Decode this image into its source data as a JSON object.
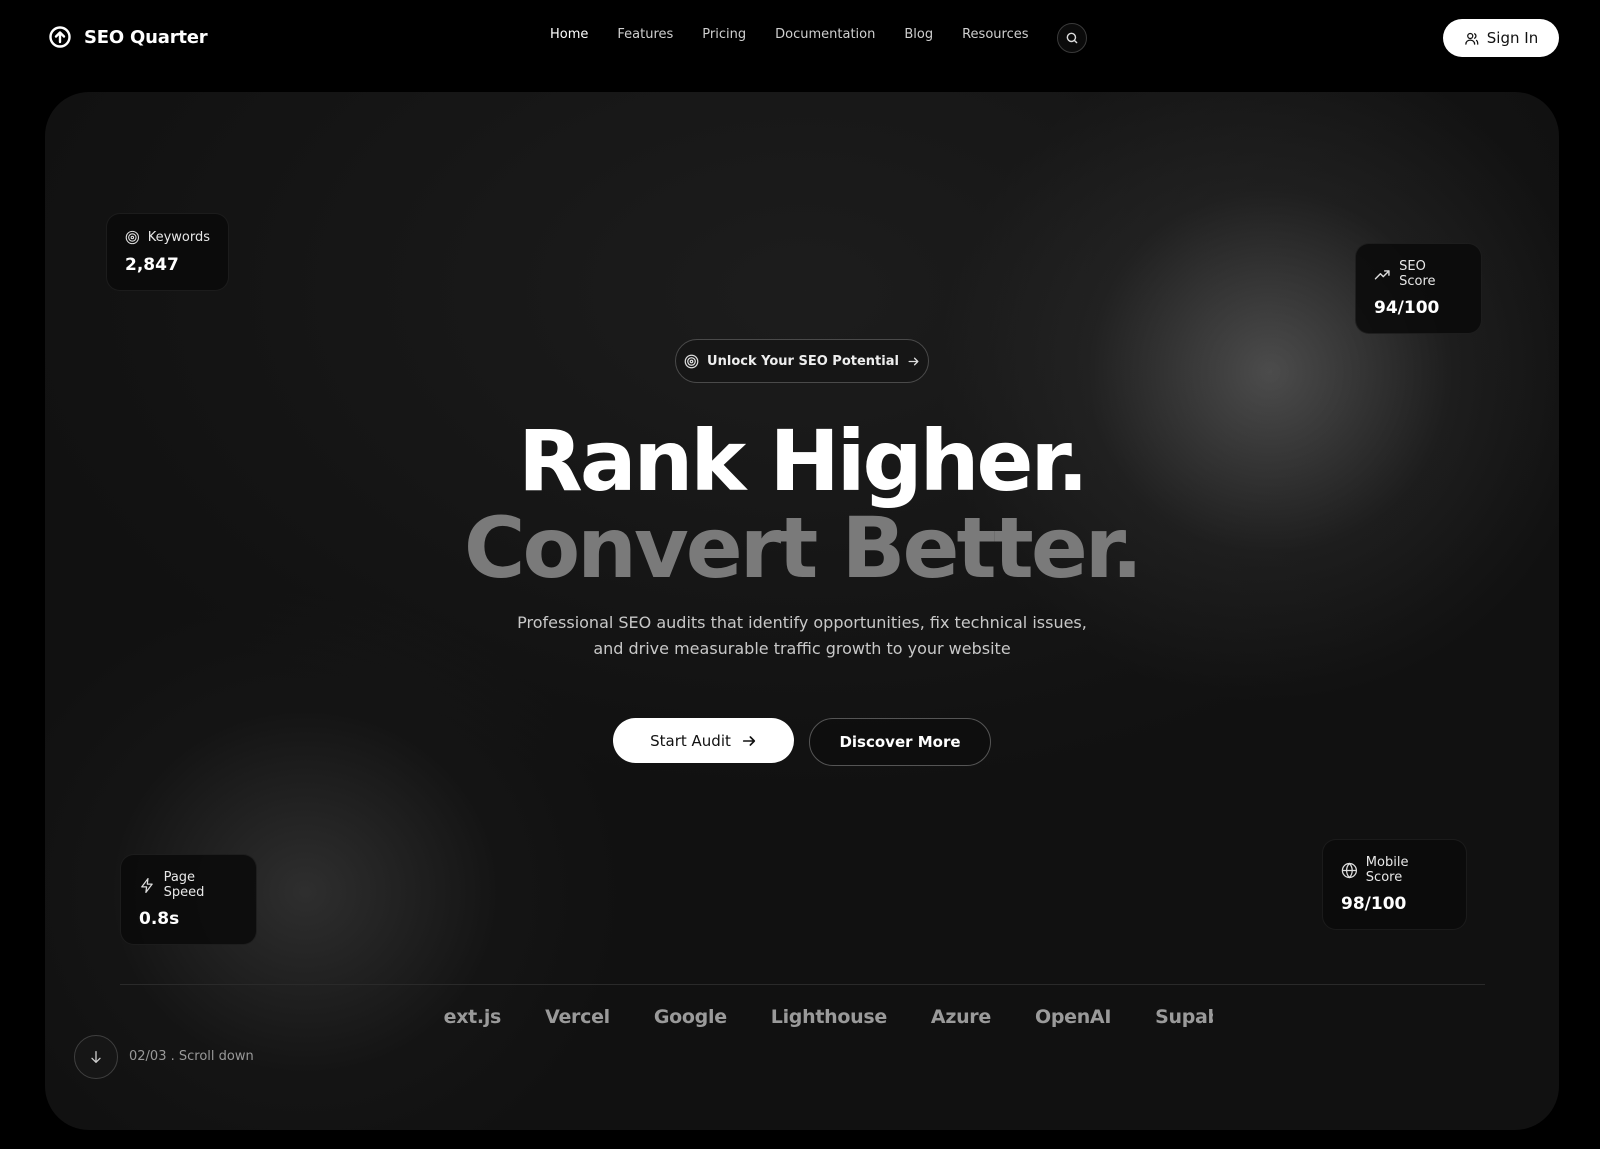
{
  "brand": {
    "name": "SEO Quarter",
    "logo_icon": "circle-arrow-up-icon"
  },
  "nav": {
    "items": [
      {
        "label": "Home",
        "active": true
      },
      {
        "label": "Features",
        "active": false
      },
      {
        "label": "Pricing",
        "active": false
      },
      {
        "label": "Documentation",
        "active": false
      },
      {
        "label": "Blog",
        "active": false
      },
      {
        "label": "Resources",
        "active": false
      }
    ],
    "search_icon": "search-icon"
  },
  "signin": {
    "label": "Sign In",
    "icon": "user-icon"
  },
  "stats": {
    "keywords": {
      "label": "Keywords",
      "value": "2,847",
      "icon": "target-icon"
    },
    "seo_score": {
      "label": "SEO Score",
      "value": "94/100",
      "icon": "trending-up-icon"
    },
    "page_speed": {
      "label": "Page Speed",
      "value": "0.8s",
      "icon": "lightning-icon"
    },
    "mobile_score": {
      "label": "Mobile Score",
      "value": "98/100",
      "icon": "globe-icon"
    }
  },
  "hero": {
    "pill_label": "Unlock Your SEO Potential",
    "headline_line1": "Rank Higher.",
    "headline_line2": "Convert Better.",
    "subtext_line1": "Professional SEO audits that identify opportunities, fix technical issues,",
    "subtext_line2": "and drive measurable traffic growth to your website",
    "primary_cta": "Start Audit",
    "secondary_cta": "Discover More"
  },
  "logos": [
    "Next.js",
    "Vercel",
    "Google",
    "Lighthouse",
    "Azure",
    "OpenAI",
    "Supabase"
  ],
  "scroll": {
    "indicator": "02/03 . Scroll down"
  },
  "colors": {
    "background": "#000000",
    "panel": "#111111",
    "accent_text": "#7a7a7a",
    "button_light": "#ffffff"
  }
}
